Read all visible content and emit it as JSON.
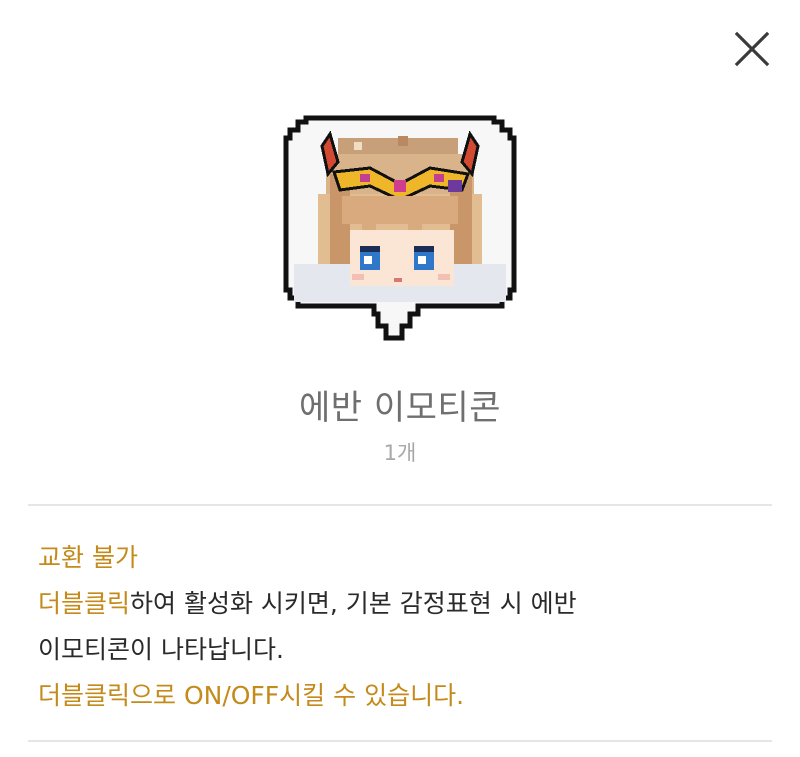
{
  "dialog": {
    "close_icon": "close-icon",
    "item": {
      "image_icon": "evan-emoticon-icon",
      "name": "에반 이모티콘",
      "count": "1개"
    },
    "description": {
      "trade_status": "교환 불가",
      "line1_highlight": "더블클릭",
      "line1_rest": "하여 활성화 시키면, 기본 감정표현 시 에반",
      "line2": "이모티콘이 나타납니다.",
      "line3": "더블클릭으로 ON/OFF시킬 수 있습니다."
    },
    "colors": {
      "highlight": "#c48a1a",
      "body_text": "#2a2a2a",
      "title_text": "#6f6f6f",
      "count_text": "#a8a8a8",
      "divider": "#e6e6e6"
    }
  }
}
